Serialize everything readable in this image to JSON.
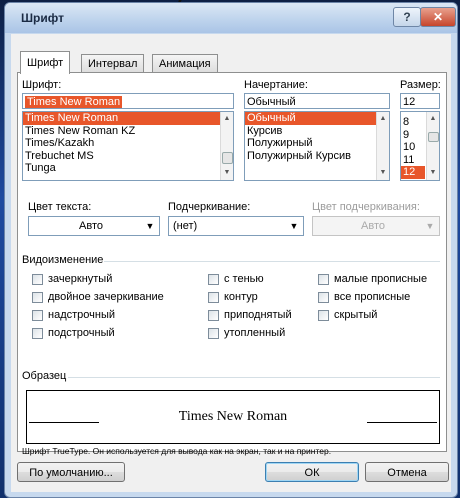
{
  "dialog": {
    "title": "Шрифт"
  },
  "tabs": [
    {
      "label": "Шрифт"
    },
    {
      "label": "Интервал"
    },
    {
      "label": "Анимация"
    }
  ],
  "font": {
    "label": "Шрифт:",
    "value": "Times New Roman",
    "list": [
      "Times New Roman",
      "Times New Roman KZ",
      "Times/Kazakh",
      "Trebuchet MS",
      "Tunga"
    ]
  },
  "style": {
    "label": "Начертание:",
    "value": "Обычный",
    "list": [
      "Обычный",
      "Курсив",
      "Полужирный",
      "Полужирный Курсив"
    ]
  },
  "size": {
    "label": "Размер:",
    "value": "12",
    "list": [
      "8",
      "9",
      "10",
      "11",
      "12"
    ]
  },
  "text_color": {
    "label": "Цвет текста:",
    "value": "Авто"
  },
  "underline": {
    "label": "Подчеркивание:",
    "value": "(нет)"
  },
  "underline_color": {
    "label": "Цвет подчеркивания:",
    "value": "Авто"
  },
  "effects": {
    "label": "Видоизменение",
    "items": [
      "зачеркнутый",
      "двойное зачеркивание",
      "надстрочный",
      "подстрочный",
      "с тенью",
      "контур",
      "приподнятый",
      "утопленный",
      "малые прописные",
      "все прописные",
      "скрытый"
    ]
  },
  "sample": {
    "label": "Образец",
    "text": "Times New Roman",
    "note": "Шрифт TrueType. Он используется для вывода как на экран, так и на принтер."
  },
  "buttons": {
    "default": "По умолчанию...",
    "ok": "ОК",
    "cancel": "Отмена"
  },
  "colors": {
    "selection": "#e8562a",
    "window_frame": "#c7d9ee",
    "close_button": "#c6452c"
  }
}
